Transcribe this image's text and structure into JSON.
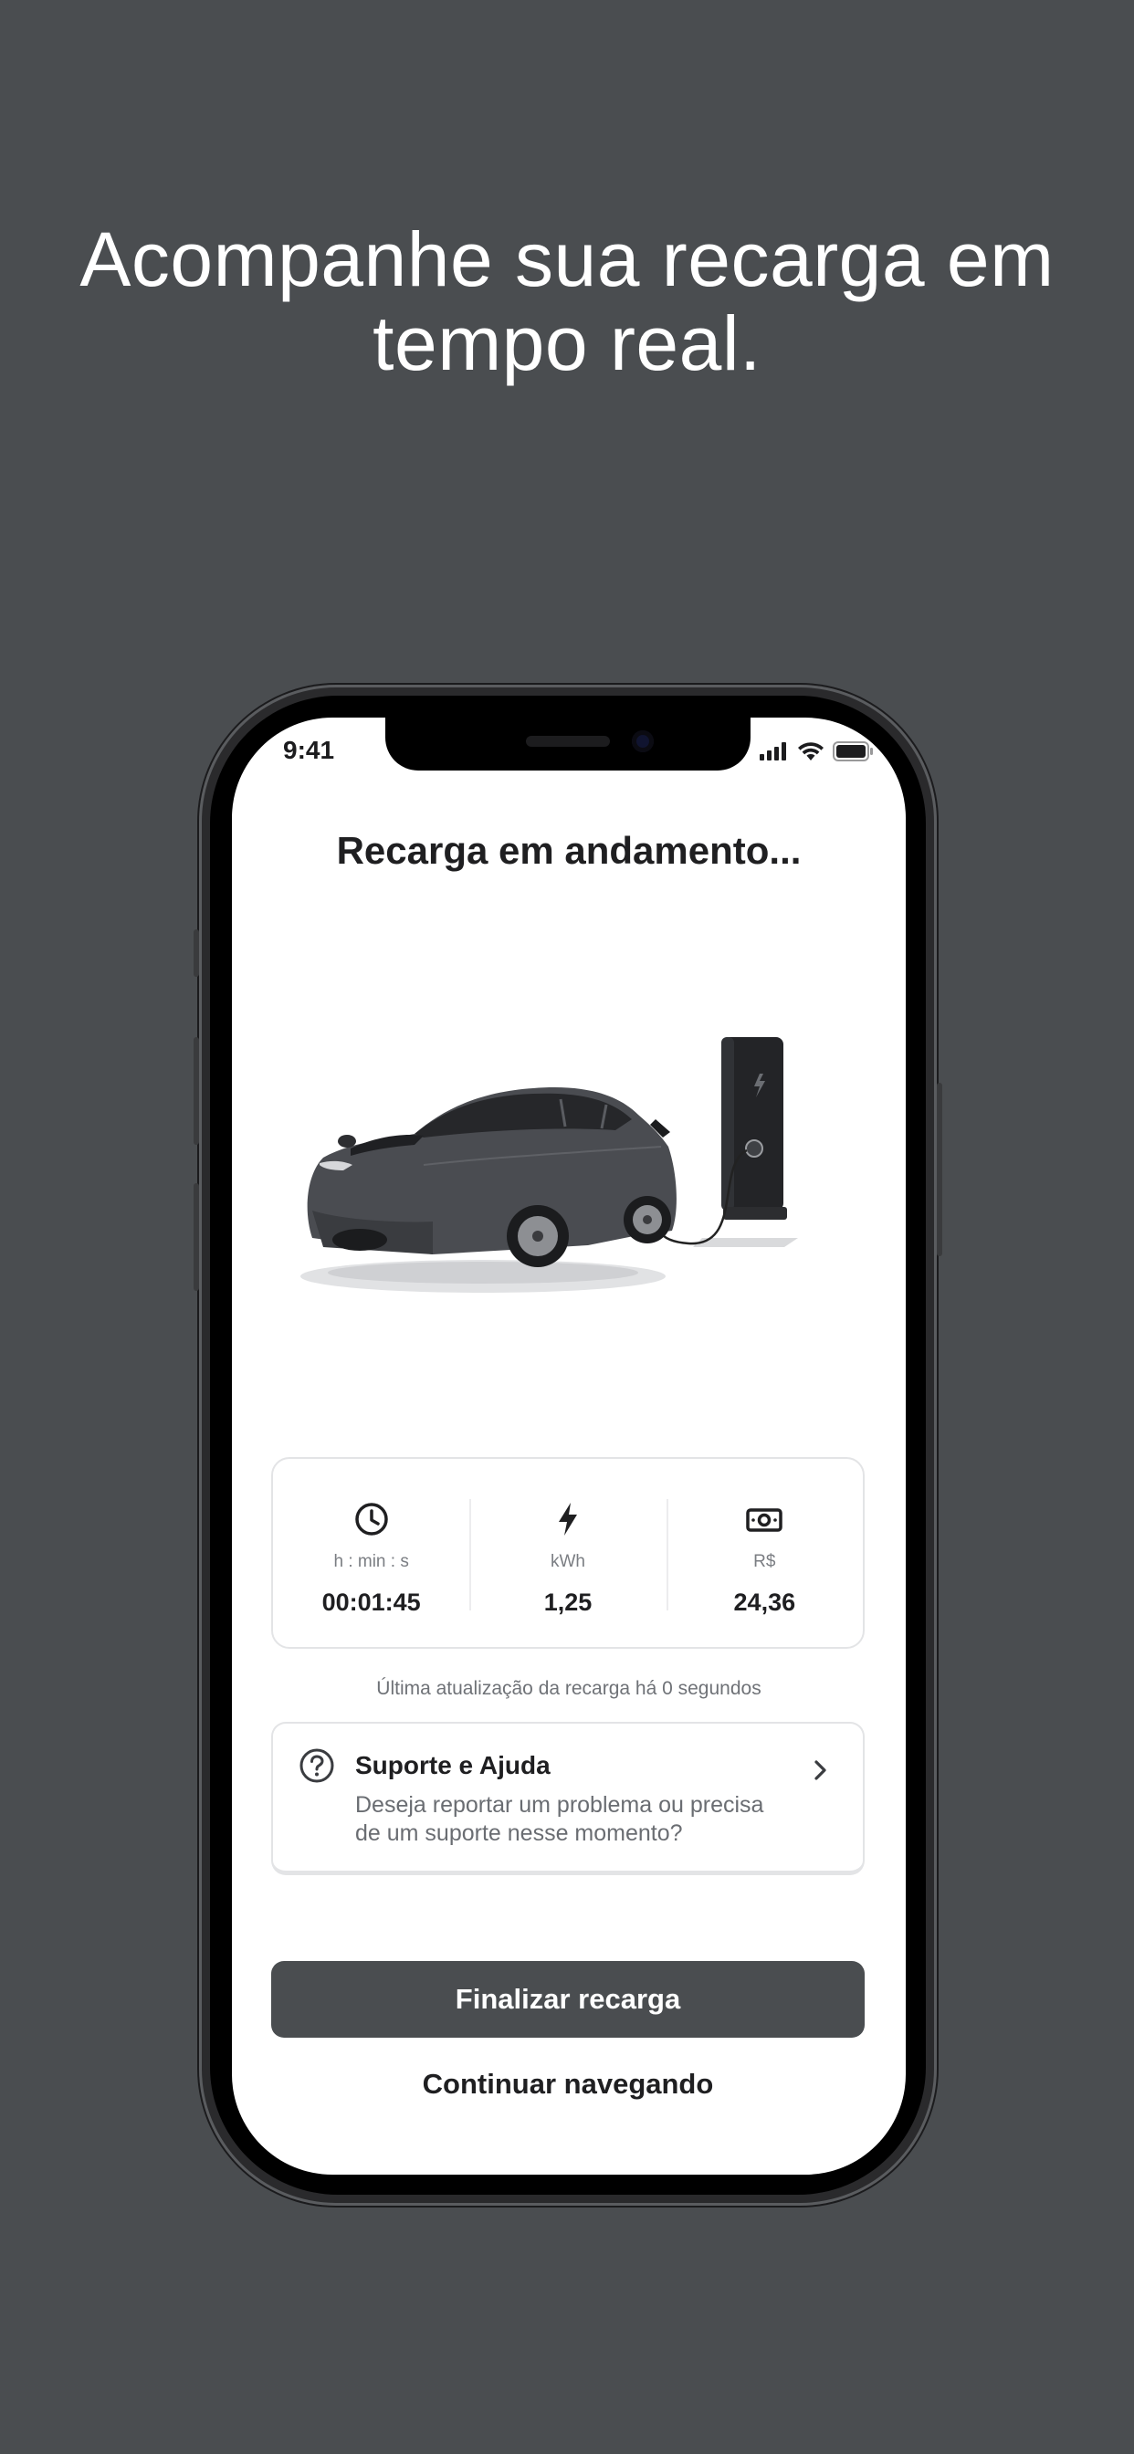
{
  "headline": {
    "line1": "Acompanhe sua recarga em",
    "line2": "tempo real."
  },
  "status_bar": {
    "time": "9:41",
    "icons": [
      "cellular-signal-icon",
      "wifi-icon",
      "battery-icon"
    ]
  },
  "screen": {
    "title": "Recarga em andamento...",
    "illustration": "electric-car-charging-illustration"
  },
  "stats": [
    {
      "icon": "clock-icon",
      "label": "h : min : s",
      "value": "00:01:45"
    },
    {
      "icon": "lightning-bolt-icon",
      "label": "kWh",
      "value": "1,25"
    },
    {
      "icon": "money-bill-icon",
      "label": "R$",
      "value": "24,36"
    }
  ],
  "update_note": "Última atualização da recarga há 0 segundos",
  "support": {
    "icon": "help-circle-icon",
    "title": "Suporte e Ajuda",
    "description": "Deseja reportar um problema ou precisa de um suporte nesse momento?",
    "chevron": "chevron-right-icon"
  },
  "actions": {
    "primary_label": "Finalizar recarga",
    "secondary_label": "Continuar navegando"
  },
  "colors": {
    "background": "#4a4d50",
    "primary_button": "#4a4d50",
    "text_dark": "#1f1f21",
    "text_muted": "#6f7277",
    "border": "#e3e4e6"
  }
}
